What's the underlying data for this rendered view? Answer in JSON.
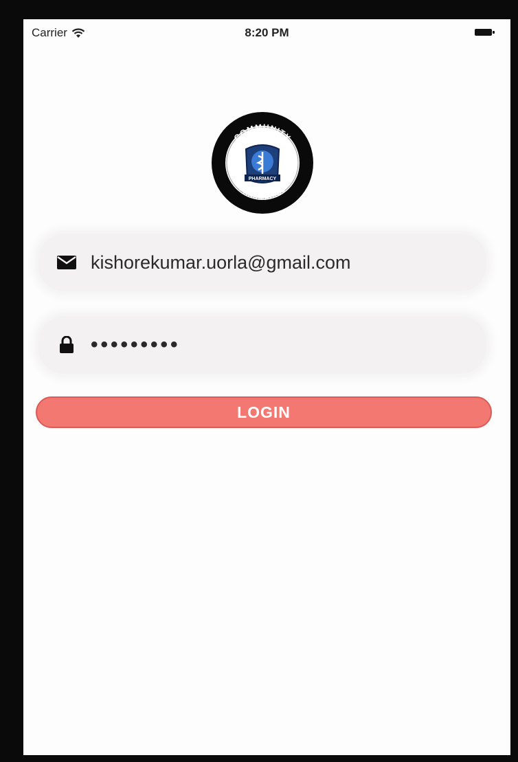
{
  "status_bar": {
    "carrier": "Carrier",
    "time": "8:20 PM"
  },
  "logo": {
    "top_text": "COMMUNITY",
    "bottom_text": "PHARMACIES",
    "center_text": "PHARMACY"
  },
  "email": {
    "value": "kishorekumar.uorla@gmail.com",
    "icon": "envelope-icon"
  },
  "password": {
    "value": "•••••••••",
    "icon": "lock-icon"
  },
  "login": {
    "label": "LOGIN"
  },
  "colors": {
    "accent": "#f47872",
    "field_bg": "#f3f1f1"
  }
}
